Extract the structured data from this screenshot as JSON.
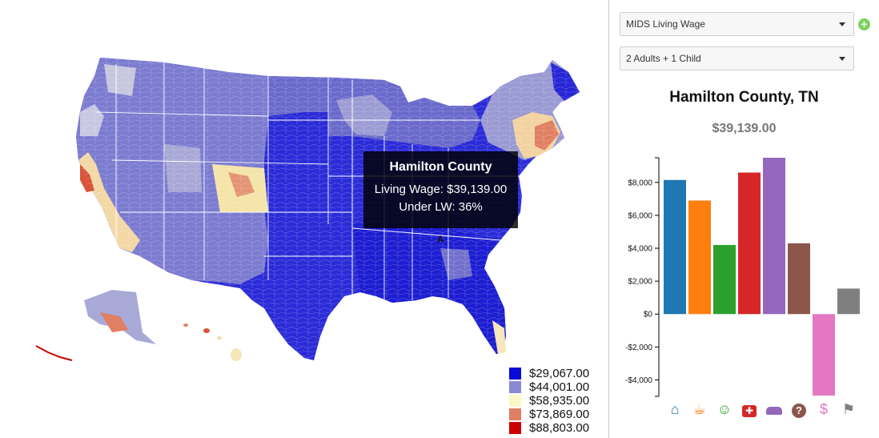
{
  "map": {
    "tooltip": {
      "title": "Hamilton County",
      "living_wage_line": "Living Wage: $39,139.00",
      "under_lw_line": "Under LW: 36%"
    },
    "marker_label": "A",
    "legend": [
      {
        "label": "$29,067.00",
        "color": "#0a0ad8"
      },
      {
        "label": "$44,001.00",
        "color": "#8a8ad2"
      },
      {
        "label": "$58,935.00",
        "color": "#fbf8c6"
      },
      {
        "label": "$73,869.00",
        "color": "#e07f62"
      },
      {
        "label": "$88,803.00",
        "color": "#cc0000"
      }
    ]
  },
  "panel": {
    "dataset_select": {
      "value": "MIDS Living Wage"
    },
    "family_select": {
      "value": "2 Adults + 1 Child"
    },
    "add_button": "+",
    "county_title": "Hamilton County, TN",
    "county_wage": "$39,139.00"
  },
  "chart_data": {
    "type": "bar",
    "title": "Hamilton County, TN",
    "subtitle": "$39,139.00",
    "categories": [
      "housing",
      "food",
      "child care",
      "medical",
      "transportation",
      "other",
      "taxes",
      "misc"
    ],
    "icons": [
      "home-icon",
      "coffee-icon",
      "child-icon",
      "medical-kit-icon",
      "car-icon",
      "question-icon",
      "money-hand-icon",
      "flag-icon"
    ],
    "values": [
      8150,
      6900,
      4200,
      8600,
      9500,
      4300,
      -4950,
      1550
    ],
    "colors": [
      "#1f77b4",
      "#ff7f0e",
      "#2ca02c",
      "#d62728",
      "#9467bd",
      "#8c564b",
      "#e377c2",
      "#7f7f7f"
    ],
    "yticks": [
      -4000,
      -2000,
      0,
      2000,
      4000,
      6000,
      8000
    ],
    "ytick_labels": [
      "-$4,000",
      "-$2,000",
      "$0",
      "$2,000",
      "$4,000",
      "$6,000",
      "$8,000"
    ],
    "ylim": [
      -5000,
      9500
    ],
    "grid": false
  }
}
